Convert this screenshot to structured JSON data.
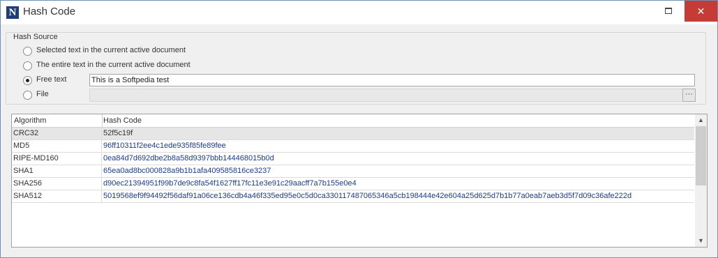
{
  "window": {
    "title": "Hash Code",
    "app_icon_letter": "N",
    "close_glyph": "✕"
  },
  "hash_source": {
    "legend": "Hash Source",
    "options": [
      {
        "label": "Selected text in the current active document",
        "checked": false
      },
      {
        "label": "The entire text in the current active document",
        "checked": false
      },
      {
        "label": "Free text",
        "checked": true
      },
      {
        "label": "File",
        "checked": false
      }
    ],
    "free_text_value": "This is a Softpedia test",
    "file_value": "",
    "browse_label": "···"
  },
  "grid": {
    "columns": [
      "Algorithm",
      "Hash Code"
    ],
    "rows": [
      {
        "algorithm": "CRC32",
        "hash": "52f5c19f",
        "selected": true
      },
      {
        "algorithm": "MD5",
        "hash": "96ff10311f2ee4c1ede935f85fe89fee",
        "selected": false
      },
      {
        "algorithm": "RIPE-MD160",
        "hash": "0ea84d7d692dbe2b8a58d9397bbb144468015b0d",
        "selected": false
      },
      {
        "algorithm": "SHA1",
        "hash": "65ea0ad8bc000828a9b1b1afa409585816ce3237",
        "selected": false
      },
      {
        "algorithm": "SHA256",
        "hash": "d90ec21394951f99b7de9c8fa54f1627ff17fc11e3e91c29aacff7a7b155e0e4",
        "selected": false
      },
      {
        "algorithm": "SHA512",
        "hash": "5019568ef9f94492f56daf91a06ce136cdb4a46f335ed95e0c5d0ca330117487065346a5cb198444e42e604a25d625d7b1b77a0eab7aeb3d5f7d09c36afe222d",
        "selected": false
      }
    ],
    "scroll_up_glyph": "▲",
    "scroll_down_glyph": "▼"
  },
  "colors": {
    "close_button": "#c53b36",
    "hash_text": "#1a3d8f",
    "window_border": "#6f8fb3"
  }
}
